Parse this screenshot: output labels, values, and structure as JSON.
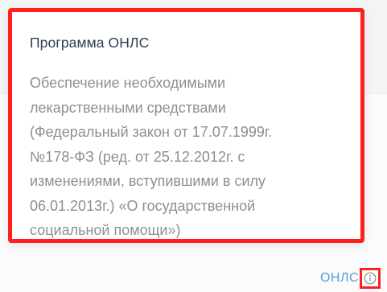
{
  "tooltip": {
    "title": "Программа ОНЛС",
    "description_lines": [
      "Обеспечение необходимыми",
      "лекарственными средствами",
      "(Федеральный закон от 17.07.1999г.",
      "№178-ФЗ (ред. от 25.12.2012г. с",
      "изменениями, вступившими в силу",
      "06.01.2013г.) «О государственной",
      "социальной помощи»)"
    ]
  },
  "footer": {
    "link_label": "ОНЛС",
    "info_icon": "info-circle-icon"
  },
  "colors": {
    "highlight": "#ff1f1f",
    "link": "#5a9bd5",
    "title": "#2c3e50",
    "body_text": "#8c8f94"
  }
}
